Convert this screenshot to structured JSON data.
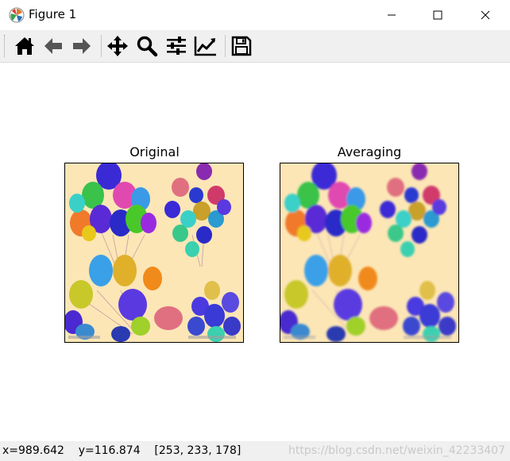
{
  "window": {
    "title": "Figure 1",
    "app_icon": "matplotlib-icon",
    "controls": [
      "minimize-icon",
      "maximize-icon",
      "close-icon"
    ]
  },
  "toolbar": {
    "tools": [
      "home-icon",
      "back-icon",
      "forward-icon",
      "pan-icon",
      "zoom-icon",
      "subplots-config-icon",
      "edit-axis-icon",
      "save-icon"
    ]
  },
  "figure": {
    "left_title": "Original",
    "right_title": "Averaging",
    "background": "#fce6b6"
  },
  "status": {
    "coords": "x=989.642    y=116.874    [253, 233, 178]",
    "watermark": "https://blog.csdn.net/weixin_42233407"
  }
}
